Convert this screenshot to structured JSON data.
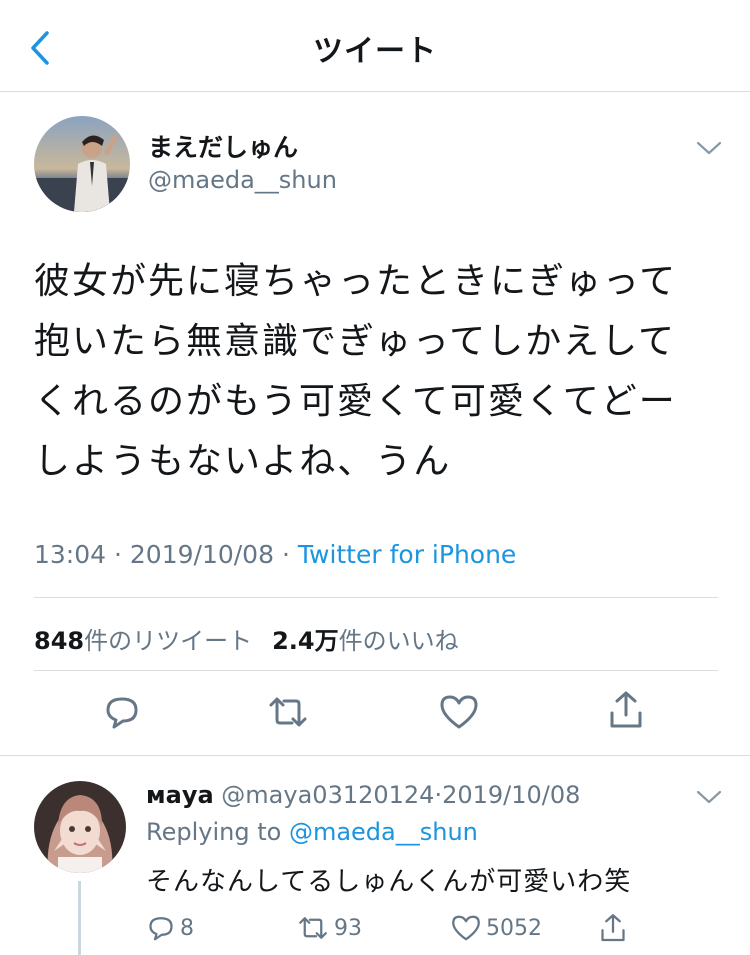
{
  "header": {
    "title": "ツイート"
  },
  "tweet": {
    "display_name": "まえだしゅん",
    "handle": "@maeda__shun",
    "lines": [
      "彼女が先に寝ちゃったときにぎゅって",
      "抱いたら無意識でぎゅってしかえして",
      "くれるのがもう可愛くて可愛くてどー",
      "しようもないよね、うん"
    ],
    "time": "13:04",
    "date": "2019/10/08",
    "separator": "·",
    "source": "Twitter for iPhone",
    "retweet_count": "848",
    "retweet_label": "件のリツイート",
    "like_count": "2.4万",
    "like_label": "件のいいね"
  },
  "reply": {
    "display_name": "маya",
    "handle": "@maya03120124",
    "separator": "·",
    "date": "2019/10/08",
    "replying_label": "Replying to",
    "replying_to": "@maeda__shun",
    "text": "そんなんしてるしゅんくんが可愛いわ笑",
    "reply_count": "8",
    "retweet_count": "93",
    "like_count": "5052"
  },
  "colors": {
    "accent": "#1b95e0",
    "secondary_text": "#657786",
    "divider": "#d8dde2"
  },
  "icons": [
    "back-chevron-icon",
    "caret-down-icon",
    "reply-icon",
    "retweet-icon",
    "like-icon",
    "share-icon"
  ]
}
